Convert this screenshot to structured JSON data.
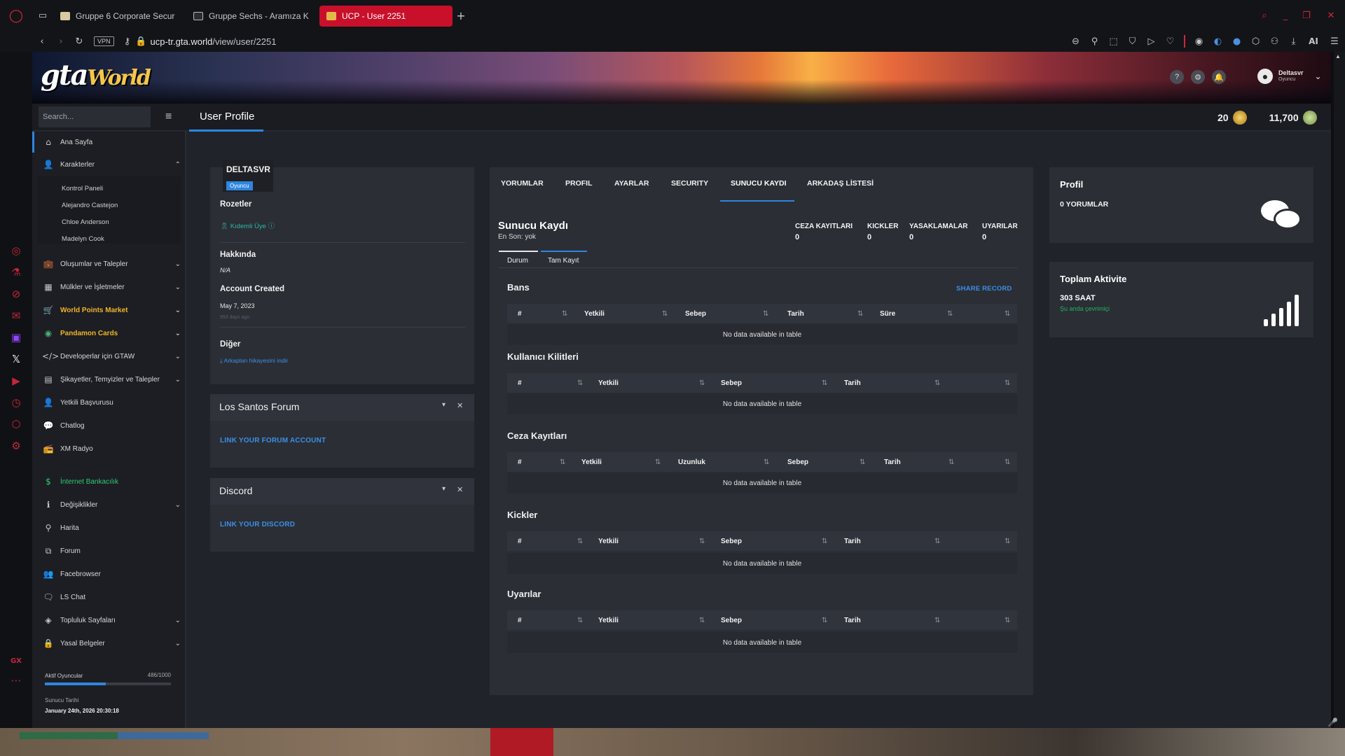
{
  "browser": {
    "tabs": [
      {
        "label": "Gruppe 6 Corporate Secur"
      },
      {
        "label": "Gruppe Sechs - Aramıza K"
      },
      {
        "label": "UCP - User 2251"
      }
    ],
    "vpn": "VPN",
    "url_host": "ucp-tr.gta.world",
    "url_path": "/view/user/2251",
    "ai": "AI"
  },
  "site": {
    "logo_main": "gta",
    "logo_sub": "World",
    "username": "Deltasvr",
    "user_role": "Oyuncu",
    "search_placeholder": "Search...",
    "page_title": "User Profile",
    "points": "20",
    "coins": "11,700"
  },
  "sidebar": {
    "items": [
      {
        "label": "Ana Sayfa"
      },
      {
        "label": "Karakterler"
      },
      {
        "label": "Oluşumlar ve Talepler"
      },
      {
        "label": "Mülkler ve İşletmeler"
      },
      {
        "label": "World Points Market"
      },
      {
        "label": "Pandamon Cards"
      },
      {
        "label": "Developerlar için GTAW"
      },
      {
        "label": "Şikayetler, Temyizler ve Talepler"
      },
      {
        "label": "Yetkili Başvurusu"
      },
      {
        "label": "Chatlog"
      },
      {
        "label": "XM Radyo"
      },
      {
        "label": "İnternet Bankacılık"
      },
      {
        "label": "Değişiklikler"
      },
      {
        "label": "Harita"
      },
      {
        "label": "Forum"
      },
      {
        "label": "Facebrowser"
      },
      {
        "label": "LS Chat"
      },
      {
        "label": "Topluluk Sayfaları"
      },
      {
        "label": "Yasal Belgeler"
      }
    ],
    "characters": [
      "Kontrol Paneli",
      "Alejandro Castejon",
      "Chloe Anderson",
      "Madelyn Cook"
    ],
    "active_players_label": "Aktif Oyuncular",
    "active_players": "486/1000",
    "active_ratio": 0.486,
    "server_date_label": "Sunucu Tarihi",
    "server_date": "January 24th, 2026 20:30:18"
  },
  "profile": {
    "name": "DELTASVR",
    "rank": "Oyuncu",
    "badges_title": "Rozetler",
    "badge": "Kıdemli Üye",
    "about_title": "Hakkında",
    "about": "N/A",
    "created_title": "Account Created",
    "created": "May 7, 2023",
    "created_ago": "993 days ago",
    "other_title": "Diğer",
    "other_link": "Arkaplan hikayesini indir"
  },
  "forum": {
    "title": "Los Santos Forum",
    "link": "LINK YOUR FORUM ACCOUNT"
  },
  "discord": {
    "title": "Discord",
    "link": "LINK YOUR DISCORD"
  },
  "tabs": [
    "YORUMLAR",
    "PROFIL",
    "AYARLAR",
    "SECURITY",
    "SUNUCU KAYDI",
    "ARKADAŞ LİSTESİ"
  ],
  "record": {
    "title": "Sunucu Kaydı",
    "subtitle": "En Son: yok",
    "stats": [
      {
        "label": "CEZA KAYITLARI",
        "value": "0"
      },
      {
        "label": "KICKLER",
        "value": "0"
      },
      {
        "label": "YASAKLAMALAR",
        "value": "0"
      },
      {
        "label": "UYARILAR",
        "value": "0"
      }
    ],
    "subtabs": [
      "Durum",
      "Tam Kayıt"
    ],
    "share": "SHARE RECORD",
    "empty": "No data available in table",
    "sections": [
      {
        "title": "Bans",
        "columns": [
          "#",
          "Yetkili",
          "Sebep",
          "Tarih",
          "Süre"
        ]
      },
      {
        "title": "Kullanıcı Kilitleri",
        "columns": [
          "#",
          "Yetkili",
          "Sebep",
          "Tarih"
        ]
      },
      {
        "title": "Ceza Kayıtları",
        "columns": [
          "#",
          "Yetkili",
          "Uzunluk",
          "Sebep",
          "Tarih"
        ]
      },
      {
        "title": "Kickler",
        "columns": [
          "#",
          "Yetkili",
          "Sebep",
          "Tarih"
        ]
      },
      {
        "title": "Uyarılar",
        "columns": [
          "#",
          "Yetkili",
          "Sebep",
          "Tarih"
        ]
      }
    ]
  },
  "right": {
    "profile_title": "Profil",
    "comments": "0 YORUMLAR",
    "activity_title": "Toplam Aktivite",
    "hours": "303 SAAT",
    "online": "Şu anda çevrimiçi"
  },
  "colors": {
    "accent": "#2e86de",
    "active_tab": "#c9102b",
    "gold": "#f0b429",
    "green": "#2ecc71"
  }
}
